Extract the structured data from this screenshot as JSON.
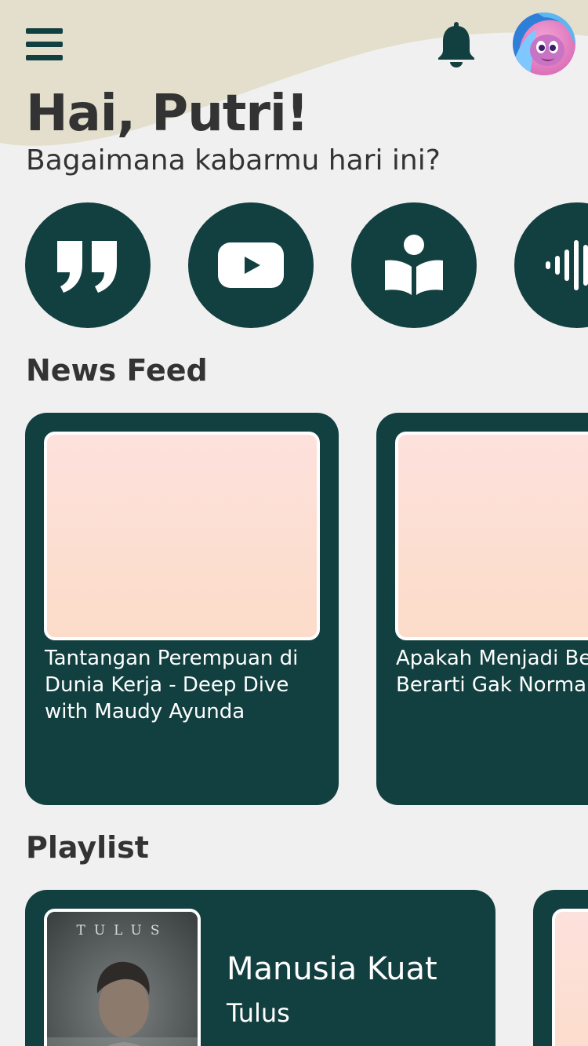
{
  "header": {
    "menu_icon": "hamburger-menu-icon",
    "notification_icon": "bell-icon",
    "avatar_icon": "pony-avatar"
  },
  "greeting": {
    "title": "Hai, Putri!",
    "subtitle": "Bagaimana kabarmu hari ini?"
  },
  "categories": [
    {
      "icon": "quote-icon"
    },
    {
      "icon": "youtube-play-icon"
    },
    {
      "icon": "reading-person-icon"
    },
    {
      "icon": "audio-waveform-icon"
    }
  ],
  "news_feed": {
    "title": "News Feed",
    "items": [
      {
        "title": "Tantangan Perempuan di\nDunia Kerja - Deep Dive\nwith Maudy Ayunda"
      },
      {
        "title": "Apakah Menjadi Be\nBerarti Gak Norma"
      }
    ]
  },
  "playlist": {
    "title": "Playlist",
    "items": [
      {
        "song": "Manusia Kuat",
        "artist": "Tulus",
        "album_tag": "TULUS"
      }
    ]
  },
  "colors": {
    "primary": "#123f3f",
    "background": "#f0f0f0",
    "header_wave": "#e3dfcc",
    "text": "#333333",
    "thumbnail_placeholder": "#fcdcc9"
  }
}
